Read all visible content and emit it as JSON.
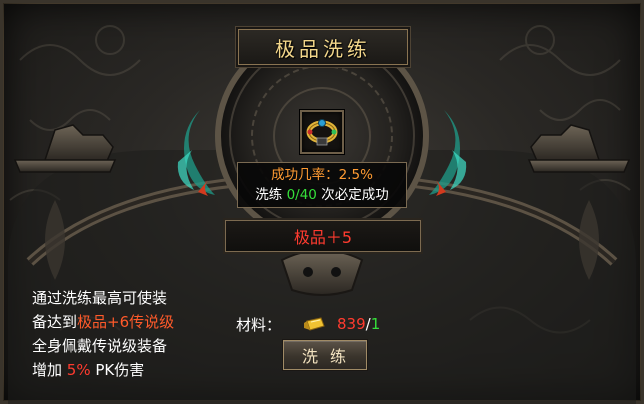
{
  "window": {
    "title": "极品洗练"
  },
  "item": {
    "icon": "gold-bracelet-icon"
  },
  "tooltip": {
    "success_label": "成功几率：",
    "success_value": "2.5%",
    "wash_label": "洗练 ",
    "wash_progress": "0/40",
    "wash_suffix": " 次必定成功"
  },
  "grade": {
    "text": "极品＋5"
  },
  "description": {
    "line1": "通过洗练最高可使装",
    "line2_prefix": "备达到",
    "line2_highlight": "极品+6传说级",
    "line3": "全身佩戴传说级装备",
    "line4_prefix": "增加 ",
    "line4_value": "5%",
    "line4_suffix": " PK伤害"
  },
  "material": {
    "label": "材料：",
    "icon": "gold-bar-icon",
    "owned": "839",
    "slash": "/",
    "required": "1"
  },
  "button": {
    "label": "洗练"
  },
  "colors": {
    "title": "#f2d68a",
    "highlight_red": "#ff3b2f",
    "success_orange": "#ff9b32",
    "progress_green": "#35e03a"
  }
}
